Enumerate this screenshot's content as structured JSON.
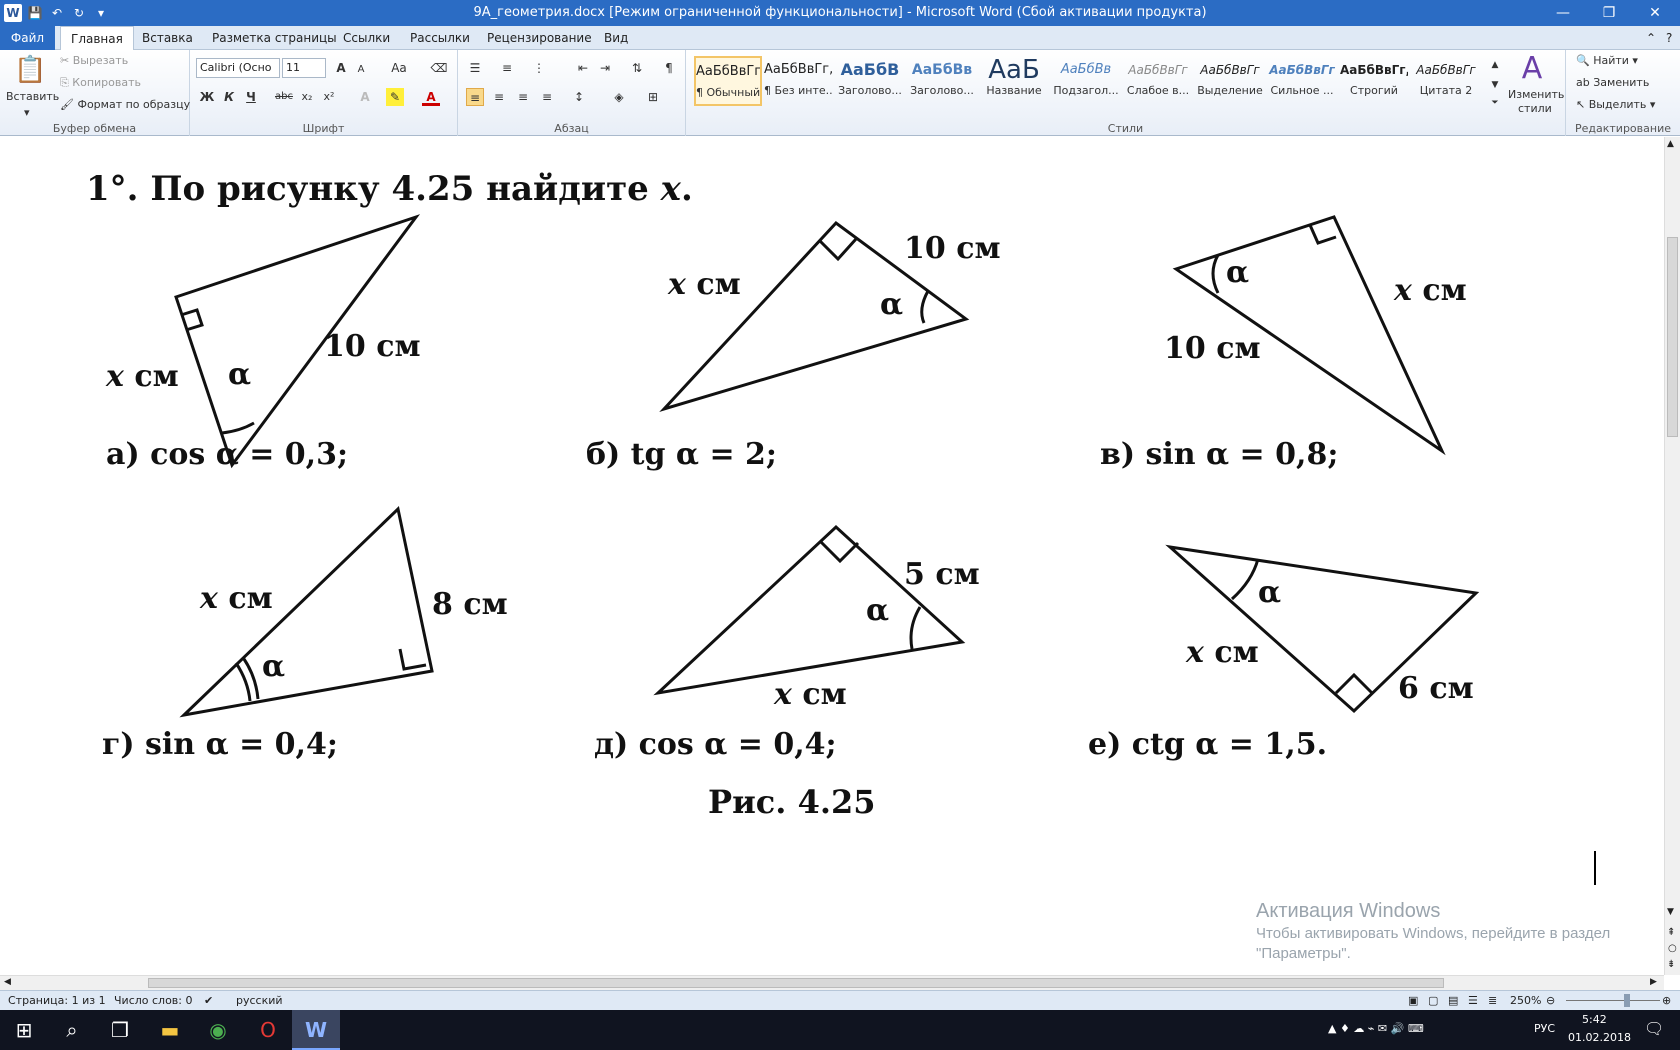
{
  "window": {
    "title": "9А_геометрия.docx [Режим ограниченной функциональности] - Microsoft Word (Сбой активации продукта)",
    "min": "—",
    "restore": "❐",
    "close": "✕"
  },
  "tabs": [
    "Файл",
    "Главная",
    "Вставка",
    "Разметка страницы",
    "Ссылки",
    "Рассылки",
    "Рецензирование",
    "Вид"
  ],
  "ribbon": {
    "clipboard": {
      "paste": "Вставить",
      "cut": "Вырезать",
      "copy": "Копировать",
      "format_painter": "Формат по образцу",
      "group": "Буфер обмена"
    },
    "font": {
      "name": "Calibri (Осно",
      "size": "11",
      "group": "Шрифт",
      "bold": "Ж",
      "italic": "К",
      "underline": "Ч",
      "strike": "abc",
      "sub": "x₂",
      "sup": "x²",
      "grow": "A",
      "shrink": "A",
      "case": "Aa"
    },
    "paragraph": {
      "group": "Абзац"
    },
    "styles": {
      "group": "Стили",
      "items": [
        {
          "sample": "АаБбВвГг,",
          "label": "¶ Обычный"
        },
        {
          "sample": "АаБбВвГг,",
          "label": "¶ Без инте..."
        },
        {
          "sample": "АаБбВ",
          "label": "Заголово..."
        },
        {
          "sample": "АаБбВв",
          "label": "Заголово..."
        },
        {
          "sample": "АаБ",
          "label": "Название"
        },
        {
          "sample": "АаБбВв",
          "label": "Подзагол..."
        },
        {
          "sample": "АаБбВвГг",
          "label": "Слабое в..."
        },
        {
          "sample": "АаБбВвГг",
          "label": "Выделение"
        },
        {
          "sample": "АаБбВвГг",
          "label": "Сильное ..."
        },
        {
          "sample": "АаБбВвГг,",
          "label": "Строгий"
        },
        {
          "sample": "АаБбВвГг",
          "label": "Цитата 2"
        }
      ],
      "change_styles_1": "Изменить",
      "change_styles_2": "стили"
    },
    "editing": {
      "group": "Редактирование",
      "find": "Найти",
      "replace": "Заменить",
      "select": "Выделить"
    }
  },
  "document": {
    "heading_prefix": "1°. По рисунку 4.25 найдите ",
    "heading_var": "x",
    "heading_suffix": ".",
    "problems": [
      {
        "label": "а) cos α = 0,3;",
        "side1": "x см",
        "side2": "10 см",
        "angle": "α"
      },
      {
        "label": "б) tg α = 2;",
        "side1": "x см",
        "side2": "10 см",
        "angle": "α"
      },
      {
        "label": "в) sin α = 0,8;",
        "side1": "10 см",
        "side2": "x см",
        "angle": "α"
      },
      {
        "label": "г) sin α = 0,4;",
        "side1": "x см",
        "side2": "8 см",
        "angle": "α"
      },
      {
        "label": "д) cos α = 0,4;",
        "side1": "x см",
        "side2": "5 см",
        "angle": "α"
      },
      {
        "label": "е) ctg α = 1,5.",
        "side1": "x см",
        "side2": "6 см",
        "angle": "α"
      }
    ],
    "caption": "Рис. 4.25"
  },
  "watermark": {
    "line1": "Активация Windows",
    "line2": "Чтобы активировать Windows, перейдите в раздел \"Параметры\"."
  },
  "status": {
    "page": "Страница: 1 из 1",
    "words": "Число слов: 0",
    "language": "русский",
    "zoom": "250%"
  },
  "taskbar": {
    "language": "РУС",
    "time": "5:42",
    "date": "01.02.2018"
  }
}
